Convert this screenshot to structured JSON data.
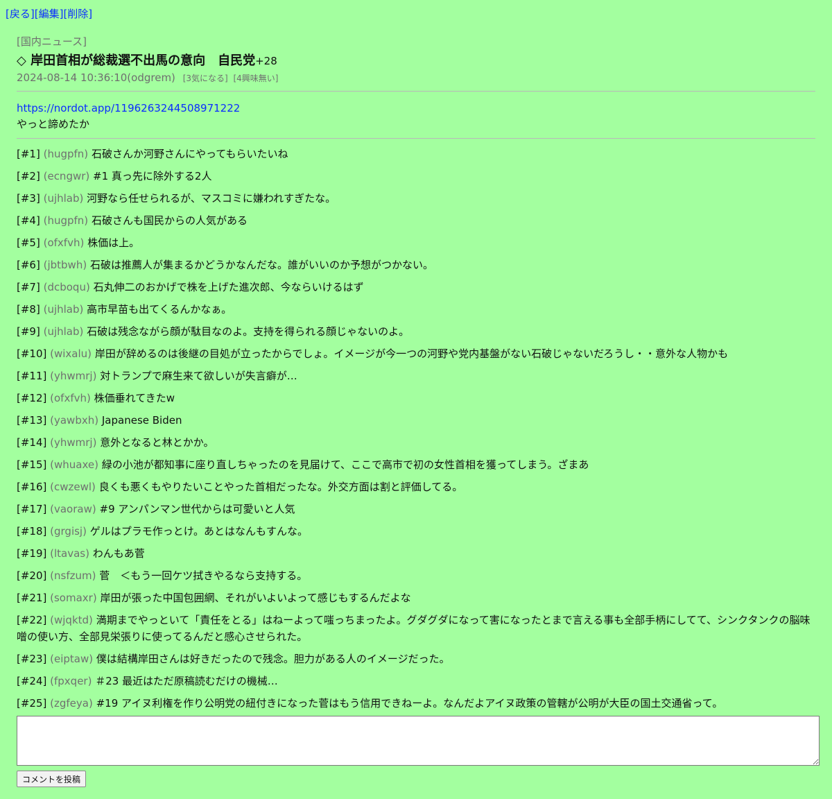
{
  "nav": {
    "back": "[戻る]",
    "edit": "[編集]",
    "delete": "[削除]"
  },
  "article": {
    "category": "[国内ニュース]",
    "title": "◇ 岸田首相が総裁選不出馬の意向　自民党",
    "score": "+28",
    "timestamp": "2024-08-14 10:36:10(odgrem)",
    "interested": "[3気になる]",
    "not_interested": "[4興味無い]",
    "url": "https://nordot.app/1196263244508971222",
    "body": "やっと諦めたか"
  },
  "comments": [
    {
      "num": "[#1]",
      "user": "(hugpfn)",
      "text": "石破さんか河野さんにやってもらいたいね"
    },
    {
      "num": "[#2]",
      "user": "(ecngwr)",
      "text": "#1 真っ先に除外する2人"
    },
    {
      "num": "[#3]",
      "user": "(ujhlab)",
      "text": "河野なら任せられるが、マスコミに嫌われすぎたな。"
    },
    {
      "num": "[#4]",
      "user": "(hugpfn)",
      "text": "石破さんも国民からの人気がある"
    },
    {
      "num": "[#5]",
      "user": "(ofxfvh)",
      "text": "株価は上。"
    },
    {
      "num": "[#6]",
      "user": "(jbtbwh)",
      "text": "石破は推薦人が集まるかどうかなんだな。誰がいいのか予想がつかない。"
    },
    {
      "num": "[#7]",
      "user": "(dcboqu)",
      "text": "石丸伸二のおかげで株を上げた進次郎、今ならいけるはず"
    },
    {
      "num": "[#8]",
      "user": "(ujhlab)",
      "text": "高市早苗も出てくるんかなぁ。"
    },
    {
      "num": "[#9]",
      "user": "(ujhlab)",
      "text": "石破は残念ながら顔が駄目なのよ。支持を得られる顔じゃないのよ。"
    },
    {
      "num": "[#10]",
      "user": "(wixalu)",
      "text": "岸田が辞めるのは後継の目処が立ったからでしょ。イメージが今一つの河野や党内基盤がない石破じゃないだろうし・・意外な人物かも"
    },
    {
      "num": "[#11]",
      "user": "(yhwmrj)",
      "text": "対トランプで麻生来て欲しいが失言癖が…"
    },
    {
      "num": "[#12]",
      "user": "(ofxfvh)",
      "text": "株価垂れてきたw"
    },
    {
      "num": "[#13]",
      "user": "(yawbxh)",
      "text": "Japanese Biden"
    },
    {
      "num": "[#14]",
      "user": "(yhwmrj)",
      "text": "意外となると林とかか。"
    },
    {
      "num": "[#15]",
      "user": "(whuaxe)",
      "text": "緑の小池が都知事に座り直しちゃったのを見届けて、ここで高市で初の女性首相を獲ってしまう。ざまあ"
    },
    {
      "num": "[#16]",
      "user": "(cwzewl)",
      "text": "良くも悪くもやりたいことやった首相だったな。外交方面は割と評価してる。"
    },
    {
      "num": "[#17]",
      "user": "(vaoraw)",
      "text": "#9 アンパンマン世代からは可愛いと人気"
    },
    {
      "num": "[#18]",
      "user": "(grgisj)",
      "text": "ゲルはプラモ作っとけ。あとはなんもすんな。"
    },
    {
      "num": "[#19]",
      "user": "(ltavas)",
      "text": "わんもあ菅"
    },
    {
      "num": "[#20]",
      "user": "(nsfzum)",
      "text": "菅　＜もう一回ケツ拭きやるなら支持する。"
    },
    {
      "num": "[#21]",
      "user": "(somaxr)",
      "text": "岸田が張った中国包囲網、それがいよいよって感じもするんだよな"
    },
    {
      "num": "[#22]",
      "user": "(wjqktd)",
      "text": "満期までやっといて「責任をとる」はねーよって嗤っちまったよ。グダグダになって害になったとまで言える事も全部手柄にしてて、シンクタンクの脳味噌の使い方、全部見栄張りに使ってるんだと感心させられた。"
    },
    {
      "num": "[#23]",
      "user": "(eiptaw)",
      "text": "僕は結構岸田さんは好きだったので残念。胆力がある人のイメージだった。"
    },
    {
      "num": "[#24]",
      "user": "(fpxqer)",
      "text": "＃23 最近はただ原稿読むだけの機械…"
    },
    {
      "num": "[#25]",
      "user": "(zgfeya)",
      "text": "#19 アイヌ利権を作り公明党の紐付きになった菅はもう信用できねーよ。なんだよアイヌ政策の管轄が公明が大臣の国土交通省って。"
    }
  ],
  "form": {
    "textarea_value": "",
    "submit_label": "コメントを投稿"
  }
}
